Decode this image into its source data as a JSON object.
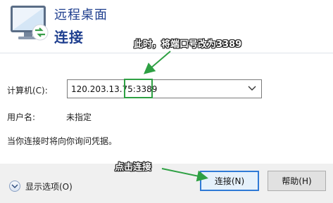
{
  "header": {
    "title": "远程桌面",
    "subtitle": "连接",
    "icon": "remote-desktop-monitor-icon"
  },
  "form": {
    "computer_label": "计算机(C):",
    "computer_value": "120.203.13.75:3389",
    "user_label": "用户名:",
    "user_value": "未指定",
    "hint": "当你连接时将向你询问凭据。"
  },
  "footer": {
    "options_label": "显示选项(O)",
    "connect_label": "连接(N)",
    "help_label": "帮助(H)"
  },
  "annotations": {
    "port_note": "此时，将端口号改为3389",
    "connect_note": "点击连接",
    "color": "#2ea043"
  }
}
